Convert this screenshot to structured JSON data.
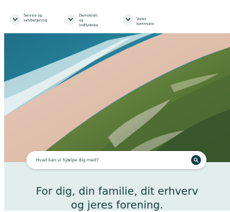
{
  "nav": {
    "items": [
      {
        "label": "Service og\nselvbetjening",
        "icon": "chevron-down-icon"
      },
      {
        "label": "Demokrati og\nindflydelse",
        "icon": "chevron-down-icon"
      },
      {
        "label": "Vores kommune",
        "icon": "chevron-down-icon"
      }
    ]
  },
  "search": {
    "placeholder": "Hvad kan vi hjælpe dig med?",
    "icon": "search-icon"
  },
  "banner": {
    "line1": "For dig, din familie, dit erhverv",
    "line2": "og jeres forening."
  },
  "colors": {
    "text_dark": "#133c3a",
    "banner_bg": "#e2eeee",
    "search_button": "#0d3b45"
  }
}
